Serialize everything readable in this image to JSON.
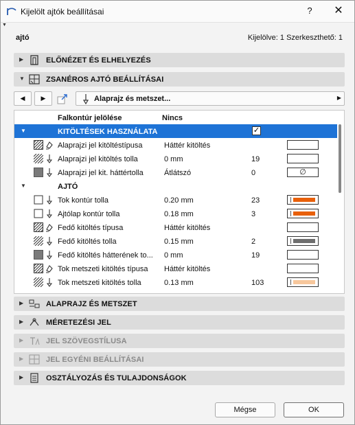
{
  "window": {
    "title": "Kijelölt ajtók beállításai",
    "help_glyph": "?",
    "close_glyph": "✕"
  },
  "header": {
    "element_name": "ajtó",
    "selection_count": "Kijelölve: 1 Szerkeszthető: 1"
  },
  "sections": {
    "preview": "ELŐNÉZET ÉS ELHELYEZÉS",
    "zsaneros": "ZSANÉROS AJTÓ BEÁLLÍTÁSAI",
    "plan_section": "ALAPRAJZ ÉS METSZET",
    "dimension_marker": "MÉRETEZÉSI JEL",
    "marker_text_style": "JEL SZÖVEGSTÍLUSA",
    "marker_custom": "JEL EGYÉNI BEÁLLÍTÁSAI",
    "classification": "OSZTÁLYOZÁS ÉS TULAJDONSÁGOK"
  },
  "toolbar": {
    "combo_label": "Alaprajz és metszet..."
  },
  "list": {
    "column_name": "Falkontúr jelölése",
    "column_value": "Nincs",
    "group_fill": {
      "title": "KITÖLTÉSEK HASZNÁLATA",
      "checked": "✓"
    },
    "group_door": {
      "title": "AJTÓ"
    },
    "rows": [
      {
        "name": "Alaprajzi jel kitöltéstípusa",
        "value": "Háttér kitöltés",
        "num": ""
      },
      {
        "name": "Alaprajzi jel kitöltés tolla",
        "value": "0 mm",
        "num": "19"
      },
      {
        "name": "Alaprajzi jel kit. háttértolla",
        "value": "Átlátszó",
        "num": "0",
        "symbol": "∅"
      },
      {
        "name": "Tok kontúr tolla",
        "value": "0.20 mm",
        "num": "23",
        "color": "#e8600a"
      },
      {
        "name": "Ajtólap kontúr tolla",
        "value": "0.18 mm",
        "num": "3",
        "color": "#e8600a"
      },
      {
        "name": "Fedő kitöltés típusa",
        "value": "Háttér kitöltés",
        "num": ""
      },
      {
        "name": "Fedő kitöltés tolla",
        "value": "0.15 mm",
        "num": "2",
        "color": "#6e6e6e"
      },
      {
        "name": "Fedő kitöltés hátterének to...",
        "value": "0 mm",
        "num": "19"
      },
      {
        "name": "Tok metszeti kitöltés típusa",
        "value": "Háttér kitöltés",
        "num": ""
      },
      {
        "name": "Tok metszeti kitöltés tolla",
        "value": "0.13 mm",
        "num": "103",
        "color": "#f7c79c"
      }
    ]
  },
  "buttons": {
    "cancel": "Mégse",
    "ok": "OK"
  },
  "colors": {
    "selection": "#1e73d6",
    "orange": "#e8600a"
  }
}
